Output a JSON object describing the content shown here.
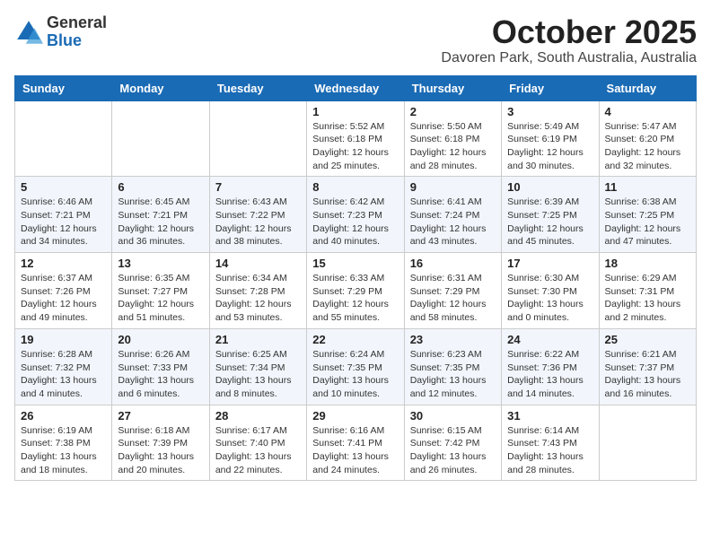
{
  "header": {
    "logo_general": "General",
    "logo_blue": "Blue",
    "month_title": "October 2025",
    "location": "Davoren Park, South Australia, Australia"
  },
  "days_of_week": [
    "Sunday",
    "Monday",
    "Tuesday",
    "Wednesday",
    "Thursday",
    "Friday",
    "Saturday"
  ],
  "weeks": [
    [
      {
        "day": "",
        "info": ""
      },
      {
        "day": "",
        "info": ""
      },
      {
        "day": "",
        "info": ""
      },
      {
        "day": "1",
        "info": "Sunrise: 5:52 AM\nSunset: 6:18 PM\nDaylight: 12 hours\nand 25 minutes."
      },
      {
        "day": "2",
        "info": "Sunrise: 5:50 AM\nSunset: 6:18 PM\nDaylight: 12 hours\nand 28 minutes."
      },
      {
        "day": "3",
        "info": "Sunrise: 5:49 AM\nSunset: 6:19 PM\nDaylight: 12 hours\nand 30 minutes."
      },
      {
        "day": "4",
        "info": "Sunrise: 5:47 AM\nSunset: 6:20 PM\nDaylight: 12 hours\nand 32 minutes."
      }
    ],
    [
      {
        "day": "5",
        "info": "Sunrise: 6:46 AM\nSunset: 7:21 PM\nDaylight: 12 hours\nand 34 minutes."
      },
      {
        "day": "6",
        "info": "Sunrise: 6:45 AM\nSunset: 7:21 PM\nDaylight: 12 hours\nand 36 minutes."
      },
      {
        "day": "7",
        "info": "Sunrise: 6:43 AM\nSunset: 7:22 PM\nDaylight: 12 hours\nand 38 minutes."
      },
      {
        "day": "8",
        "info": "Sunrise: 6:42 AM\nSunset: 7:23 PM\nDaylight: 12 hours\nand 40 minutes."
      },
      {
        "day": "9",
        "info": "Sunrise: 6:41 AM\nSunset: 7:24 PM\nDaylight: 12 hours\nand 43 minutes."
      },
      {
        "day": "10",
        "info": "Sunrise: 6:39 AM\nSunset: 7:25 PM\nDaylight: 12 hours\nand 45 minutes."
      },
      {
        "day": "11",
        "info": "Sunrise: 6:38 AM\nSunset: 7:25 PM\nDaylight: 12 hours\nand 47 minutes."
      }
    ],
    [
      {
        "day": "12",
        "info": "Sunrise: 6:37 AM\nSunset: 7:26 PM\nDaylight: 12 hours\nand 49 minutes."
      },
      {
        "day": "13",
        "info": "Sunrise: 6:35 AM\nSunset: 7:27 PM\nDaylight: 12 hours\nand 51 minutes."
      },
      {
        "day": "14",
        "info": "Sunrise: 6:34 AM\nSunset: 7:28 PM\nDaylight: 12 hours\nand 53 minutes."
      },
      {
        "day": "15",
        "info": "Sunrise: 6:33 AM\nSunset: 7:29 PM\nDaylight: 12 hours\nand 55 minutes."
      },
      {
        "day": "16",
        "info": "Sunrise: 6:31 AM\nSunset: 7:29 PM\nDaylight: 12 hours\nand 58 minutes."
      },
      {
        "day": "17",
        "info": "Sunrise: 6:30 AM\nSunset: 7:30 PM\nDaylight: 13 hours\nand 0 minutes."
      },
      {
        "day": "18",
        "info": "Sunrise: 6:29 AM\nSunset: 7:31 PM\nDaylight: 13 hours\nand 2 minutes."
      }
    ],
    [
      {
        "day": "19",
        "info": "Sunrise: 6:28 AM\nSunset: 7:32 PM\nDaylight: 13 hours\nand 4 minutes."
      },
      {
        "day": "20",
        "info": "Sunrise: 6:26 AM\nSunset: 7:33 PM\nDaylight: 13 hours\nand 6 minutes."
      },
      {
        "day": "21",
        "info": "Sunrise: 6:25 AM\nSunset: 7:34 PM\nDaylight: 13 hours\nand 8 minutes."
      },
      {
        "day": "22",
        "info": "Sunrise: 6:24 AM\nSunset: 7:35 PM\nDaylight: 13 hours\nand 10 minutes."
      },
      {
        "day": "23",
        "info": "Sunrise: 6:23 AM\nSunset: 7:35 PM\nDaylight: 13 hours\nand 12 minutes."
      },
      {
        "day": "24",
        "info": "Sunrise: 6:22 AM\nSunset: 7:36 PM\nDaylight: 13 hours\nand 14 minutes."
      },
      {
        "day": "25",
        "info": "Sunrise: 6:21 AM\nSunset: 7:37 PM\nDaylight: 13 hours\nand 16 minutes."
      }
    ],
    [
      {
        "day": "26",
        "info": "Sunrise: 6:19 AM\nSunset: 7:38 PM\nDaylight: 13 hours\nand 18 minutes."
      },
      {
        "day": "27",
        "info": "Sunrise: 6:18 AM\nSunset: 7:39 PM\nDaylight: 13 hours\nand 20 minutes."
      },
      {
        "day": "28",
        "info": "Sunrise: 6:17 AM\nSunset: 7:40 PM\nDaylight: 13 hours\nand 22 minutes."
      },
      {
        "day": "29",
        "info": "Sunrise: 6:16 AM\nSunset: 7:41 PM\nDaylight: 13 hours\nand 24 minutes."
      },
      {
        "day": "30",
        "info": "Sunrise: 6:15 AM\nSunset: 7:42 PM\nDaylight: 13 hours\nand 26 minutes."
      },
      {
        "day": "31",
        "info": "Sunrise: 6:14 AM\nSunset: 7:43 PM\nDaylight: 13 hours\nand 28 minutes."
      },
      {
        "day": "",
        "info": ""
      }
    ]
  ]
}
